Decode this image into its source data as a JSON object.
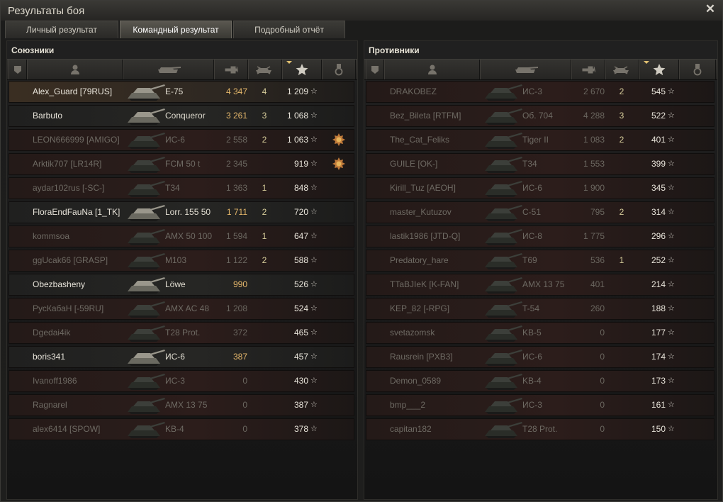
{
  "window": {
    "title": "Результаты боя"
  },
  "tabs": [
    {
      "label": "Личный результат",
      "active": false
    },
    {
      "label": "Командный результат",
      "active": true
    },
    {
      "label": "Подробный отчёт",
      "active": false
    }
  ],
  "allies": {
    "title": "Союзники",
    "rows": [
      {
        "name": "Alex_Guard [79RUS]",
        "vehicle": "E-75",
        "damage": "4 347",
        "kills": "4",
        "xp": "1 209",
        "medal": false,
        "alive": true,
        "me": true
      },
      {
        "name": "Barbuto",
        "vehicle": "Conqueror",
        "damage": "3 261",
        "kills": "3",
        "xp": "1 068",
        "medal": false,
        "alive": true,
        "me": false
      },
      {
        "name": "LEON666999 [AMIGO]",
        "vehicle": "ИС-6",
        "damage": "2 558",
        "kills": "2",
        "xp": "1 063",
        "medal": true,
        "alive": false,
        "me": false
      },
      {
        "name": "Arktik707 [LR14R]",
        "vehicle": "FCM 50 t",
        "damage": "2 345",
        "kills": "",
        "xp": "919",
        "medal": true,
        "alive": false,
        "me": false
      },
      {
        "name": "aydar102rus [-SC-]",
        "vehicle": "T34",
        "damage": "1 363",
        "kills": "1",
        "xp": "848",
        "medal": false,
        "alive": false,
        "me": false
      },
      {
        "name": "FloraEndFauNa [1_TK]",
        "vehicle": "Lorr. 155 50",
        "damage": "1 711",
        "kills": "2",
        "xp": "720",
        "medal": false,
        "alive": true,
        "me": false
      },
      {
        "name": "kommsoa",
        "vehicle": "AMX 50 100",
        "damage": "1 594",
        "kills": "1",
        "xp": "647",
        "medal": false,
        "alive": false,
        "me": false
      },
      {
        "name": "ggUcak66 [GRASP]",
        "vehicle": "M103",
        "damage": "1 122",
        "kills": "2",
        "xp": "588",
        "medal": false,
        "alive": false,
        "me": false
      },
      {
        "name": "Obezbasheny",
        "vehicle": "Löwe",
        "damage": "990",
        "kills": "",
        "xp": "526",
        "medal": false,
        "alive": true,
        "me": false
      },
      {
        "name": "РусКабаН [-59RU]",
        "vehicle": "AMX AC 48",
        "damage": "1 208",
        "kills": "",
        "xp": "524",
        "medal": false,
        "alive": false,
        "me": false
      },
      {
        "name": "Dgedai4ik",
        "vehicle": "T28 Prot.",
        "damage": "372",
        "kills": "",
        "xp": "465",
        "medal": false,
        "alive": false,
        "me": false
      },
      {
        "name": "boris341",
        "vehicle": "ИС-6",
        "damage": "387",
        "kills": "",
        "xp": "457",
        "medal": false,
        "alive": true,
        "me": false
      },
      {
        "name": "Ivanoff1986",
        "vehicle": "ИС-3",
        "damage": "0",
        "kills": "",
        "xp": "430",
        "medal": false,
        "alive": false,
        "me": false
      },
      {
        "name": "Ragnarel",
        "vehicle": "AMX 13 75",
        "damage": "0",
        "kills": "",
        "xp": "387",
        "medal": false,
        "alive": false,
        "me": false
      },
      {
        "name": "alex6414 [SPOW]",
        "vehicle": "KB-4",
        "damage": "0",
        "kills": "",
        "xp": "378",
        "medal": false,
        "alive": false,
        "me": false
      }
    ]
  },
  "enemies": {
    "title": "Противники",
    "rows": [
      {
        "name": "DRAKOBEZ",
        "vehicle": "ИС-3",
        "damage": "2 670",
        "kills": "2",
        "xp": "545",
        "medal": false,
        "alive": false,
        "me": false
      },
      {
        "name": "Bez_Bileta [RTFM]",
        "vehicle": "Об. 704",
        "damage": "4 288",
        "kills": "3",
        "xp": "522",
        "medal": false,
        "alive": false,
        "me": false
      },
      {
        "name": "The_Cat_Feliks",
        "vehicle": "Tiger II",
        "damage": "1 083",
        "kills": "2",
        "xp": "401",
        "medal": false,
        "alive": false,
        "me": false
      },
      {
        "name": "GUILE [OK-]",
        "vehicle": "T34",
        "damage": "1 553",
        "kills": "",
        "xp": "399",
        "medal": false,
        "alive": false,
        "me": false
      },
      {
        "name": "Kirill_Tuz [AEOH]",
        "vehicle": "ИС-6",
        "damage": "1 900",
        "kills": "",
        "xp": "345",
        "medal": false,
        "alive": false,
        "me": false
      },
      {
        "name": "master_Kutuzov",
        "vehicle": "С-51",
        "damage": "795",
        "kills": "2",
        "xp": "314",
        "medal": false,
        "alive": false,
        "me": false
      },
      {
        "name": "lastik1986 [JTD-Q]",
        "vehicle": "ИС-8",
        "damage": "1 775",
        "kills": "",
        "xp": "296",
        "medal": false,
        "alive": false,
        "me": false
      },
      {
        "name": "Predatory_hare",
        "vehicle": "T69",
        "damage": "536",
        "kills": "1",
        "xp": "252",
        "medal": false,
        "alive": false,
        "me": false
      },
      {
        "name": "TTaBJIeK [K-FAN]",
        "vehicle": "AMX 13 75",
        "damage": "401",
        "kills": "",
        "xp": "214",
        "medal": false,
        "alive": false,
        "me": false
      },
      {
        "name": "KEP_82 [-RPG]",
        "vehicle": "T-54",
        "damage": "260",
        "kills": "",
        "xp": "188",
        "medal": false,
        "alive": false,
        "me": false
      },
      {
        "name": "svetazomsk",
        "vehicle": "KB-5",
        "damage": "0",
        "kills": "",
        "xp": "177",
        "medal": false,
        "alive": false,
        "me": false
      },
      {
        "name": "Rausrein [PXB3]",
        "vehicle": "ИС-6",
        "damage": "0",
        "kills": "",
        "xp": "174",
        "medal": false,
        "alive": false,
        "me": false
      },
      {
        "name": "Demon_0589",
        "vehicle": "KB-4",
        "damage": "0",
        "kills": "",
        "xp": "173",
        "medal": false,
        "alive": false,
        "me": false
      },
      {
        "name": "bmp___2",
        "vehicle": "ИС-3",
        "damage": "0",
        "kills": "",
        "xp": "161",
        "medal": false,
        "alive": false,
        "me": false
      },
      {
        "name": "capitan182",
        "vehicle": "T28 Prot.",
        "damage": "0",
        "kills": "",
        "xp": "150",
        "medal": false,
        "alive": false,
        "me": false
      }
    ]
  },
  "columns": [
    {
      "key": "squad",
      "icon": "squad-icon"
    },
    {
      "key": "player",
      "icon": "player-icon"
    },
    {
      "key": "vehicle",
      "icon": "tank-icon"
    },
    {
      "key": "damage",
      "icon": "gun-damage-icon"
    },
    {
      "key": "kills",
      "icon": "destroyed-tank-icon"
    },
    {
      "key": "xp",
      "icon": "star-xp-icon",
      "sorted": true
    },
    {
      "key": "medals",
      "icon": "medal-icon"
    }
  ],
  "colors": {
    "alive_damage": "#e2b56a",
    "dead_row": "#2c1d1b",
    "active_tab": "#5a5750"
  }
}
